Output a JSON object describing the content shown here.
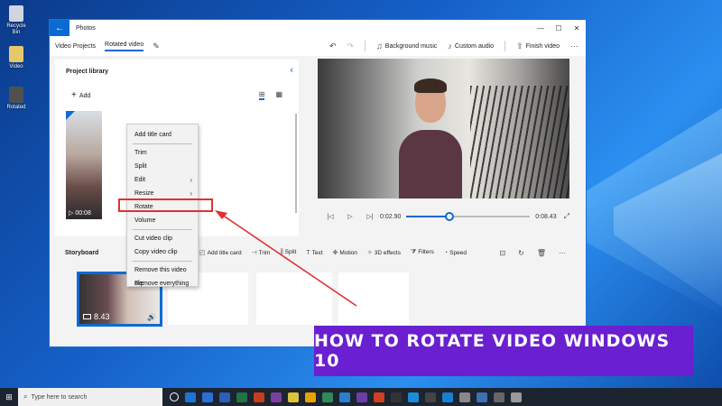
{
  "desktop": {
    "icons": [
      {
        "label": "Recycle Bin",
        "color": "#cfd6df"
      },
      {
        "label": "Video",
        "color": "#e6c86a"
      },
      {
        "label": "Rotated",
        "color": "#505050"
      }
    ]
  },
  "window": {
    "app_title": "Photos",
    "breadcrumbs": [
      "Video Projects",
      "Rotated video"
    ],
    "toolbar": {
      "background_music": "Background music",
      "custom_audio": "Custom audio",
      "finish_video": "Finish video"
    }
  },
  "library": {
    "title": "Project library",
    "add_label": "Add",
    "thumb_duration": "00:08"
  },
  "player": {
    "current_time": "0:02.90",
    "total_time": "0:08.43",
    "progress_fraction": 0.35
  },
  "storyboard": {
    "title": "Storyboard",
    "tools": [
      {
        "icon": "◰",
        "label": "Add title card"
      },
      {
        "icon": "⊣",
        "label": "Trim"
      },
      {
        "icon": "⫼",
        "label": "Split"
      },
      {
        "icon": "T",
        "label": "Text"
      },
      {
        "icon": "✥",
        "label": "Motion"
      },
      {
        "icon": "✧",
        "label": "3D effects"
      },
      {
        "icon": "⧩",
        "label": "Filters"
      },
      {
        "icon": "◔",
        "label": "Speed"
      }
    ],
    "clip_duration": "8.43"
  },
  "context_menu": {
    "groups": [
      [
        "Add title card"
      ],
      [
        "Trim",
        "Split",
        "Edit",
        "Resize",
        "Rotate",
        "Volume"
      ],
      [
        "Cut video clip",
        "Copy video clip"
      ],
      [
        "Remove this video clip",
        "Remove everything"
      ]
    ],
    "submenu_items": [
      "Edit",
      "Resize"
    ],
    "highlighted_item": "Rotate"
  },
  "banner": {
    "text": "HOW TO ROTATE VIDEO WINDOWS 10",
    "color": "#6a1fd0"
  },
  "taskbar": {
    "search_placeholder": "Type here to search",
    "app_colors": [
      "#e8e8e8",
      "#1e74d4",
      "#2a6fd8",
      "#2b5fb4",
      "#217346",
      "#c43e1c",
      "#7b3fa0",
      "#dcc33a",
      "#e8a200",
      "#2e8b57",
      "#2a7fd0",
      "#6b3ea5",
      "#d04020",
      "#333333",
      "#1c8adb",
      "#444444",
      "#1a7fd0",
      "#888888",
      "#3b6fb6",
      "#666666",
      "#999999"
    ]
  },
  "colors": {
    "accent": "#0b6bd3",
    "highlight_box": "#e03131"
  }
}
